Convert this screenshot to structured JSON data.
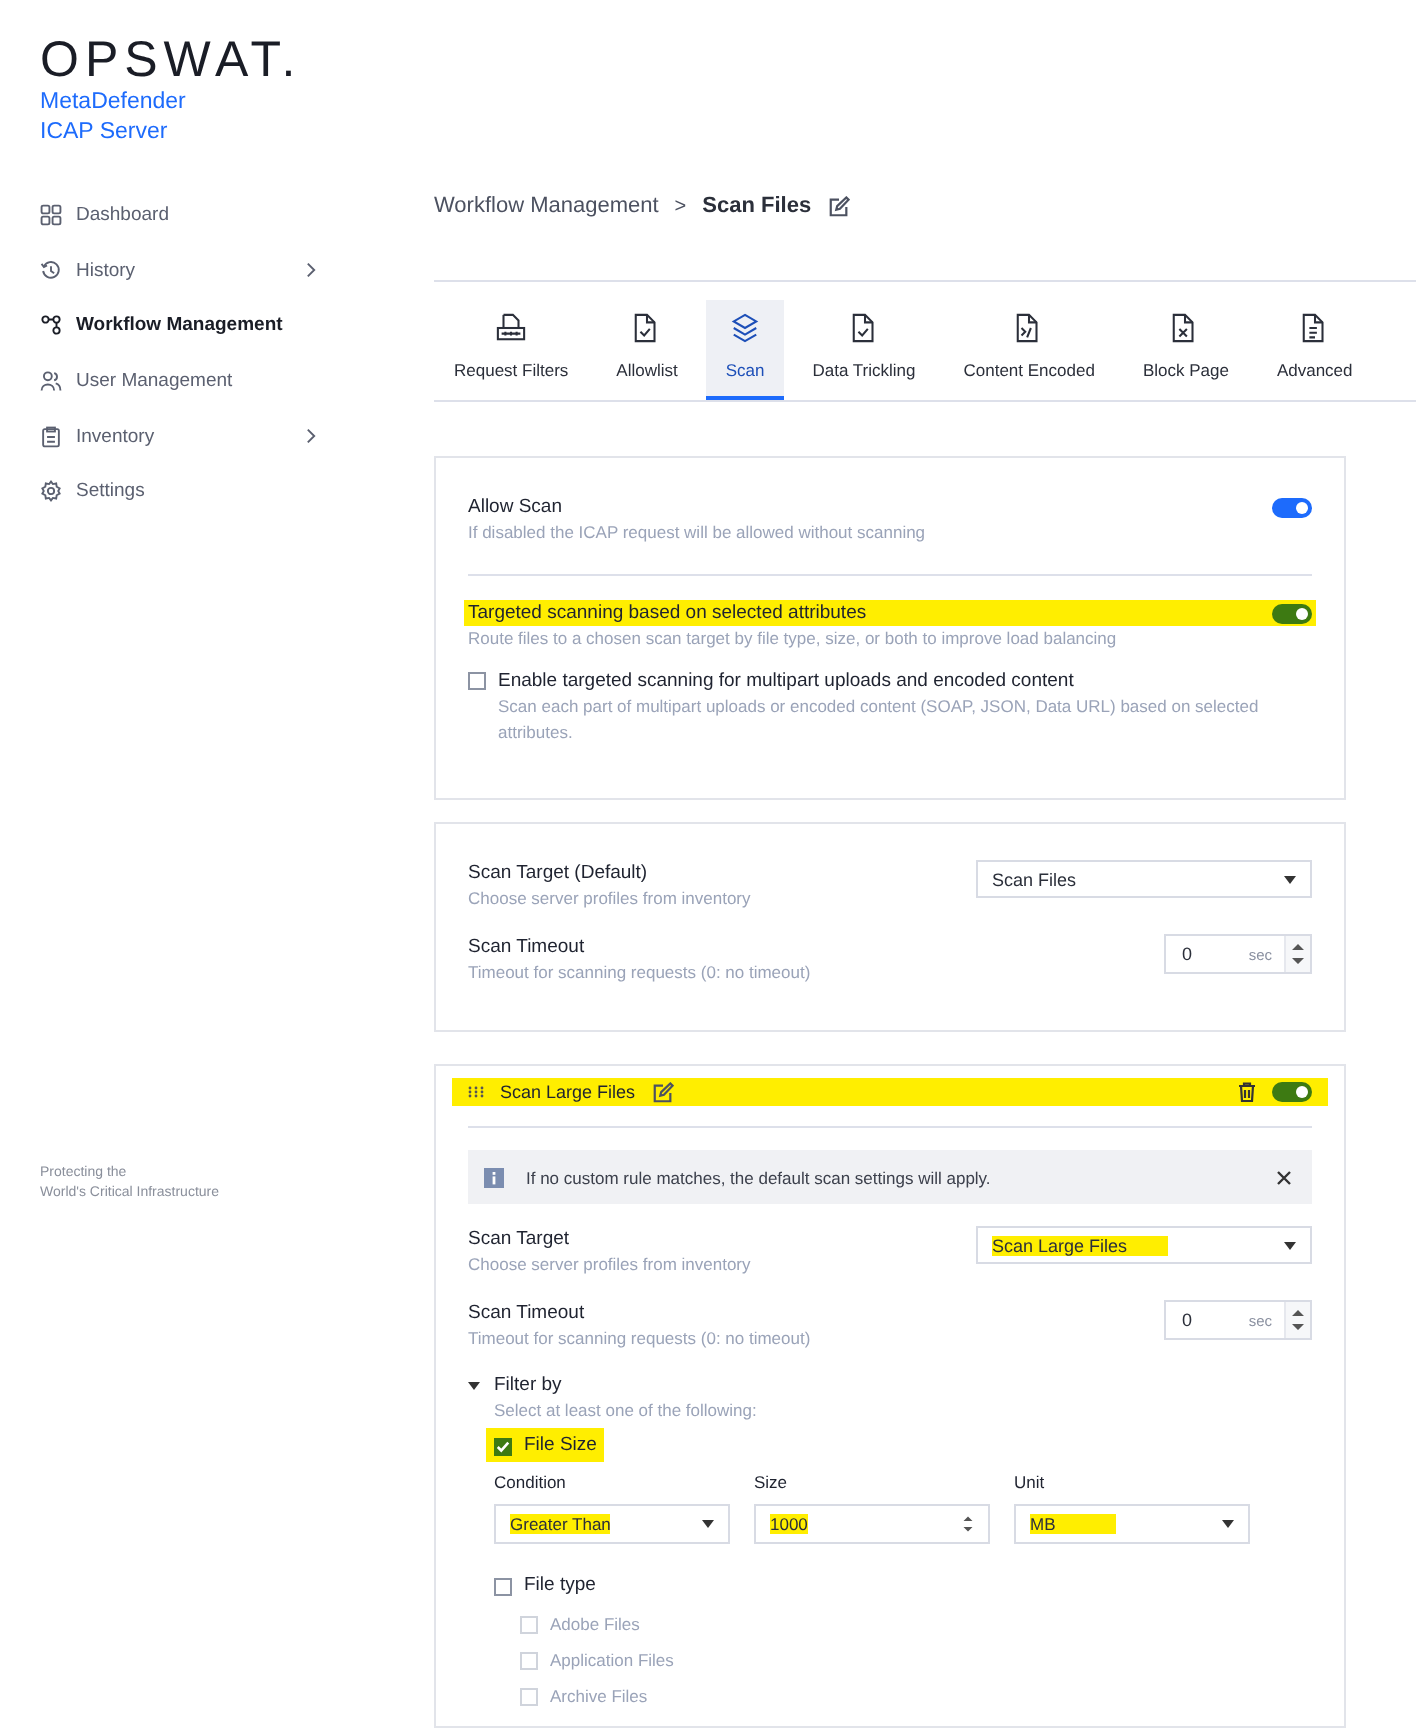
{
  "sidebar": {
    "logo": "OPSWAT.",
    "product": [
      "MetaDefender",
      "ICAP Server"
    ],
    "items": [
      {
        "label": "Dashboard",
        "selected": false,
        "has_submenu": false
      },
      {
        "label": "History",
        "selected": false,
        "has_submenu": true
      },
      {
        "label": "Workflow Management",
        "selected": true,
        "has_submenu": false
      },
      {
        "label": "User Management",
        "selected": false,
        "has_submenu": false
      },
      {
        "label": "Inventory",
        "selected": false,
        "has_submenu": true
      },
      {
        "label": "Settings",
        "selected": false,
        "has_submenu": false
      }
    ],
    "footer": [
      "Protecting the",
      "World's Critical Infrastructure"
    ]
  },
  "breadcrumb": {
    "parent": "Workflow Management",
    "separator": ">",
    "current": "Scan Files"
  },
  "tabs": [
    {
      "label": "Request Filters",
      "selected": false
    },
    {
      "label": "Allowlist",
      "selected": false
    },
    {
      "label": "Scan",
      "selected": true
    },
    {
      "label": "Data Trickling",
      "selected": false
    },
    {
      "label": "Content Encoded",
      "selected": false
    },
    {
      "label": "Block Page",
      "selected": false
    },
    {
      "label": "Advanced",
      "selected": false
    }
  ],
  "general_card": {
    "allow_scan": {
      "label": "Allow Scan",
      "description": "If disabled the ICAP request will be allowed without scanning",
      "on": true,
      "highlighted": false
    },
    "targeted": {
      "label": "Targeted scanning based on selected attributes",
      "description": "Route files to a chosen scan target by file type, size, or both to improve load balancing",
      "on": true,
      "highlighted": true
    },
    "multipart": {
      "label": "Enable targeted scanning for multipart uploads and encoded content",
      "description": "Scan each part of multipart uploads or encoded content (SOAP, JSON, Data URL) based on selected attributes.",
      "checked": false
    }
  },
  "defaults_card": {
    "scan_target": {
      "label": "Scan Target (Default)",
      "description": "Choose server profiles from inventory",
      "value": "Scan Files",
      "highlighted": false
    },
    "scan_timeout": {
      "label": "Scan Timeout",
      "description": "Timeout for scanning requests (0: no timeout)",
      "value": "0",
      "unit": "sec"
    }
  },
  "rule_card": {
    "name": "Scan Large Files",
    "highlighted": true,
    "on": true,
    "notice": "If no custom rule matches, the default scan settings will apply.",
    "scan_target": {
      "label": "Scan Target",
      "description": "Choose server profiles from inventory",
      "value": "Scan Large Files",
      "highlighted": true
    },
    "scan_timeout": {
      "label": "Scan Timeout",
      "description": "Timeout for scanning requests (0: no timeout)",
      "value": "0",
      "unit": "sec"
    },
    "filter": {
      "label": "Filter by",
      "expanded": true,
      "hint": "Select at least one of the following:",
      "file_size": {
        "label": "File Size",
        "checked": true,
        "highlighted": true,
        "columns": [
          "Condition",
          "Size",
          "Unit"
        ],
        "condition": "Greater Than",
        "size": "1000",
        "unit": "MB",
        "values_highlighted": true
      },
      "file_type": {
        "label": "File type",
        "checked": false,
        "options": [
          {
            "label": "Adobe Files",
            "checked": false
          },
          {
            "label": "Application Files",
            "checked": false
          },
          {
            "label": "Archive Files",
            "checked": false
          }
        ]
      }
    }
  }
}
